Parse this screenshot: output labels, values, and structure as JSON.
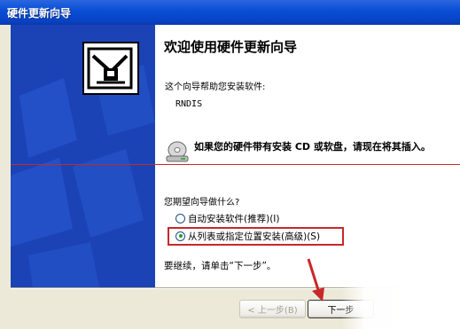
{
  "window": {
    "title": "硬件更新向导"
  },
  "wizard": {
    "heading": "欢迎使用硬件更新向导",
    "description": "这个向导帮助您安装软件:",
    "device_name": "RNDIS",
    "cd_hint": "如果您的硬件带有安装 CD 或软盘，请现在将其插入。",
    "question": "您期望向导做什么?",
    "options": [
      {
        "label": "自动安装软件(推荐)(I)",
        "selected": false
      },
      {
        "label": "从列表或指定位置安装(高级)(S)",
        "selected": true
      }
    ],
    "continue_text": "要继续，请单击“下一步”。"
  },
  "buttons": {
    "back_label": "< 上一步(B)",
    "next_label": "下一步"
  },
  "icons": {
    "wizard_logo": "hardware-wizard-icon",
    "cd": "cd-drive-icon",
    "annotation_arrow": "red-arrow-icon"
  },
  "colors": {
    "titlebar": "#0a4fd6",
    "side_panel": "#1b43b6",
    "annotation_red": "#c8282a",
    "radio_dot": "#21a121"
  }
}
